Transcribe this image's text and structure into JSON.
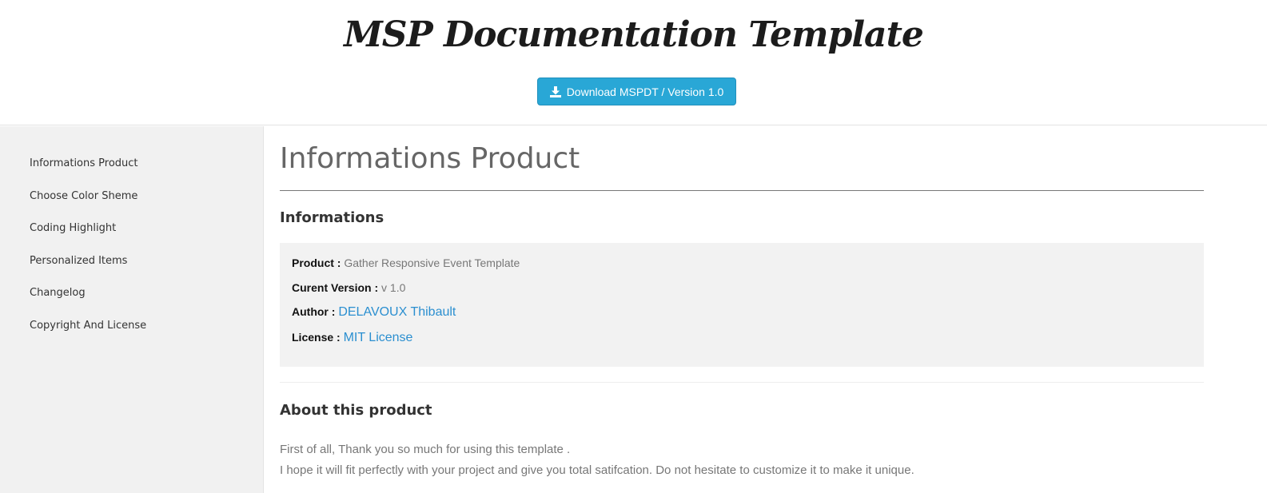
{
  "header": {
    "title": "MSP Documentation Template",
    "download_label": "Download MSPDT / Version 1.0",
    "download_icon": "download-icon"
  },
  "sidebar": {
    "items": [
      {
        "label": "Informations Product"
      },
      {
        "label": "Choose Color Sheme"
      },
      {
        "label": "Coding Highlight"
      },
      {
        "label": "Personalized Items"
      },
      {
        "label": "Changelog"
      },
      {
        "label": "Copyright And License"
      }
    ]
  },
  "main": {
    "title": "Informations Product",
    "informations_heading": "Informations",
    "info": {
      "product_label": "Product :",
      "product_value": "Gather Responsive Event Template",
      "version_label": "Curent Version :",
      "version_value": "v 1.0",
      "author_label": "Author :",
      "author_value": "DELAVOUX Thibault",
      "license_label": "License :",
      "license_value": "MIT License"
    },
    "about_heading": "About this product",
    "about_lines": [
      "First of all, Thank you so much for using this template .",
      "I hope it will fit perfectly with your project and give you total satifcation. Do not hesitate to customize it to make it unique."
    ]
  },
  "colors": {
    "accent": "#29a7d6",
    "link": "#2b8fd0",
    "sidebar_bg": "#f1f1f1",
    "info_bg": "#f2f2f2"
  }
}
